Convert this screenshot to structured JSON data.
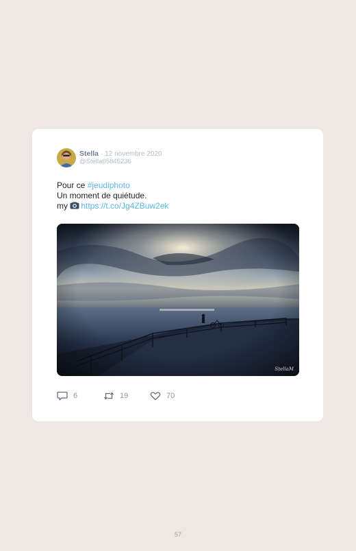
{
  "tweet": {
    "author_name": "Stella",
    "separator": "·",
    "date": "12 novembre 2020",
    "handle": "@Stella05845236",
    "text_line1_prefix": "Pour ce ",
    "hashtag": "#jeudiphoto",
    "text_line2": "Un moment de quiétude.",
    "text_line3_prefix": "my ",
    "camera_icon": "camera-icon",
    "link": "https://t.co/Jg4ZBuw2ek",
    "photo_signature": "StellaM",
    "replies": "6",
    "retweets": "19",
    "likes": "70"
  },
  "page": {
    "number": "57"
  },
  "colors": {
    "background": "#efe7e2",
    "card": "#ffffff",
    "link": "#5ab4e6",
    "muted": "#8a97a6"
  }
}
